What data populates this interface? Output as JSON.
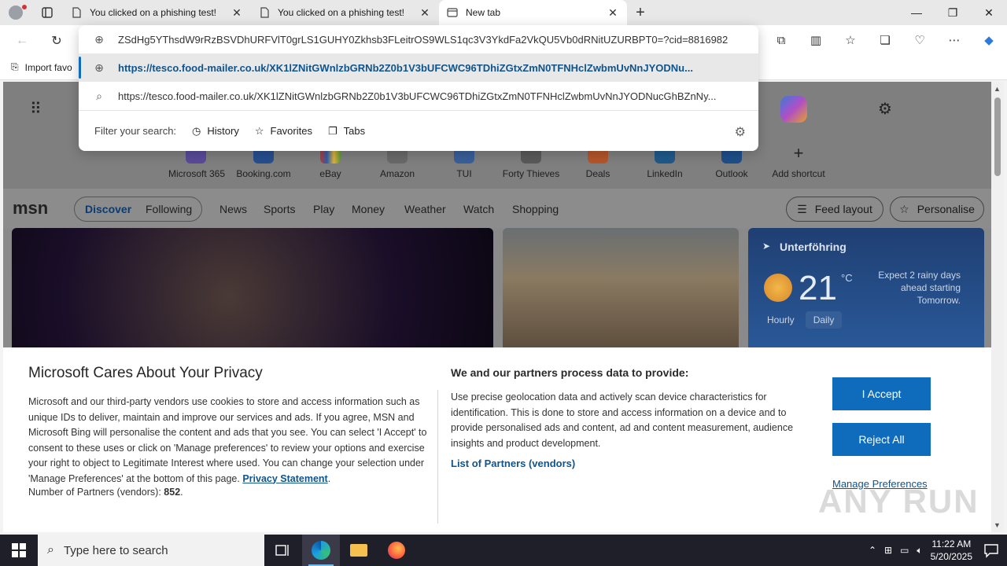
{
  "tabs": [
    {
      "title": "You clicked on a phishing test!"
    },
    {
      "title": "You clicked on a phishing test!"
    },
    {
      "title": "New tab"
    }
  ],
  "favorites": {
    "import_label": "Import favo"
  },
  "omnibox": {
    "rows": [
      {
        "text": "ZSdHg5YThsdW9rRzBSVDhURFVlT0grLS1GUHY0Zkhsb3FLeitrOS9WLS1qc3V3YkdFa2VkQU5Vb0dRNitUZURBPT0=?cid=8816982"
      },
      {
        "text": "https://tesco.food-mailer.co.uk/XK1lZNitGWnlzbGRNb2Z0b1V3bUFCWC96TDhiZGtxZmN0TFNHclZwbmUvNnJYODNu..."
      },
      {
        "text": "https://tesco.food-mailer.co.uk/XK1lZNitGWnlzbGRNb2Z0b1V3bUFCWC96TDhiZGtxZmN0TFNHclZwbmUvNnJYODNucGhBZnNy..."
      }
    ],
    "filter_label": "Filter your search:",
    "filters": [
      "History",
      "Favorites",
      "Tabs"
    ]
  },
  "shortcuts": [
    "Microsoft 365",
    "Booking.com",
    "eBay",
    "Amazon",
    "TUI",
    "Forty Thieves",
    "Deals",
    "LinkedIn",
    "Outlook",
    "Add shortcut"
  ],
  "msn": {
    "logo": "msn",
    "nav": [
      "Discover",
      "Following",
      "News",
      "Sports",
      "Play",
      "Money",
      "Weather",
      "Watch",
      "Shopping"
    ],
    "feed_layout": "Feed layout",
    "personalise": "Personalise"
  },
  "weather": {
    "location": "Unterföhring",
    "temp": "21",
    "unit": "°C",
    "description": "Expect 2 rainy days ahead starting Tomorrow.",
    "tabs": [
      "Hourly",
      "Daily"
    ]
  },
  "privacy": {
    "title": "Microsoft Cares About Your Privacy",
    "body": "Microsoft and our third-party vendors use cookies to store and access information such as unique IDs to deliver, maintain and improve our services and ads. If you agree, MSN and Microsoft Bing will personalise the content and ads that you see. You can select 'I Accept' to consent to these uses or click on 'Manage preferences' to review your options and exercise your right to object to Legitimate Interest where used.  You can change your selection under 'Manage Preferences' at the bottom of this page.",
    "privacy_link": "Privacy Statement",
    "partners_label": "Number of Partners (vendors):",
    "partners_count": "852",
    "middle_title": "We and our partners process data to provide:",
    "middle_text": "Use precise geolocation data and actively scan device characteristics for identification. This is done to store and access information on a device and to provide personalised ads and content, ad and content measurement, audience insights and product development.",
    "partners_link": "List of Partners (vendors)",
    "accept": "I Accept",
    "reject": "Reject All",
    "manage": "Manage Preferences"
  },
  "watermark": "ANY RUN",
  "taskbar": {
    "search_placeholder": "Type here to search",
    "time": "11:22 AM",
    "date": "5/20/2025"
  },
  "colors": {
    "accent": "#0f6cbd",
    "link": "#0f548c",
    "taskbar": "#1f1f2a"
  }
}
